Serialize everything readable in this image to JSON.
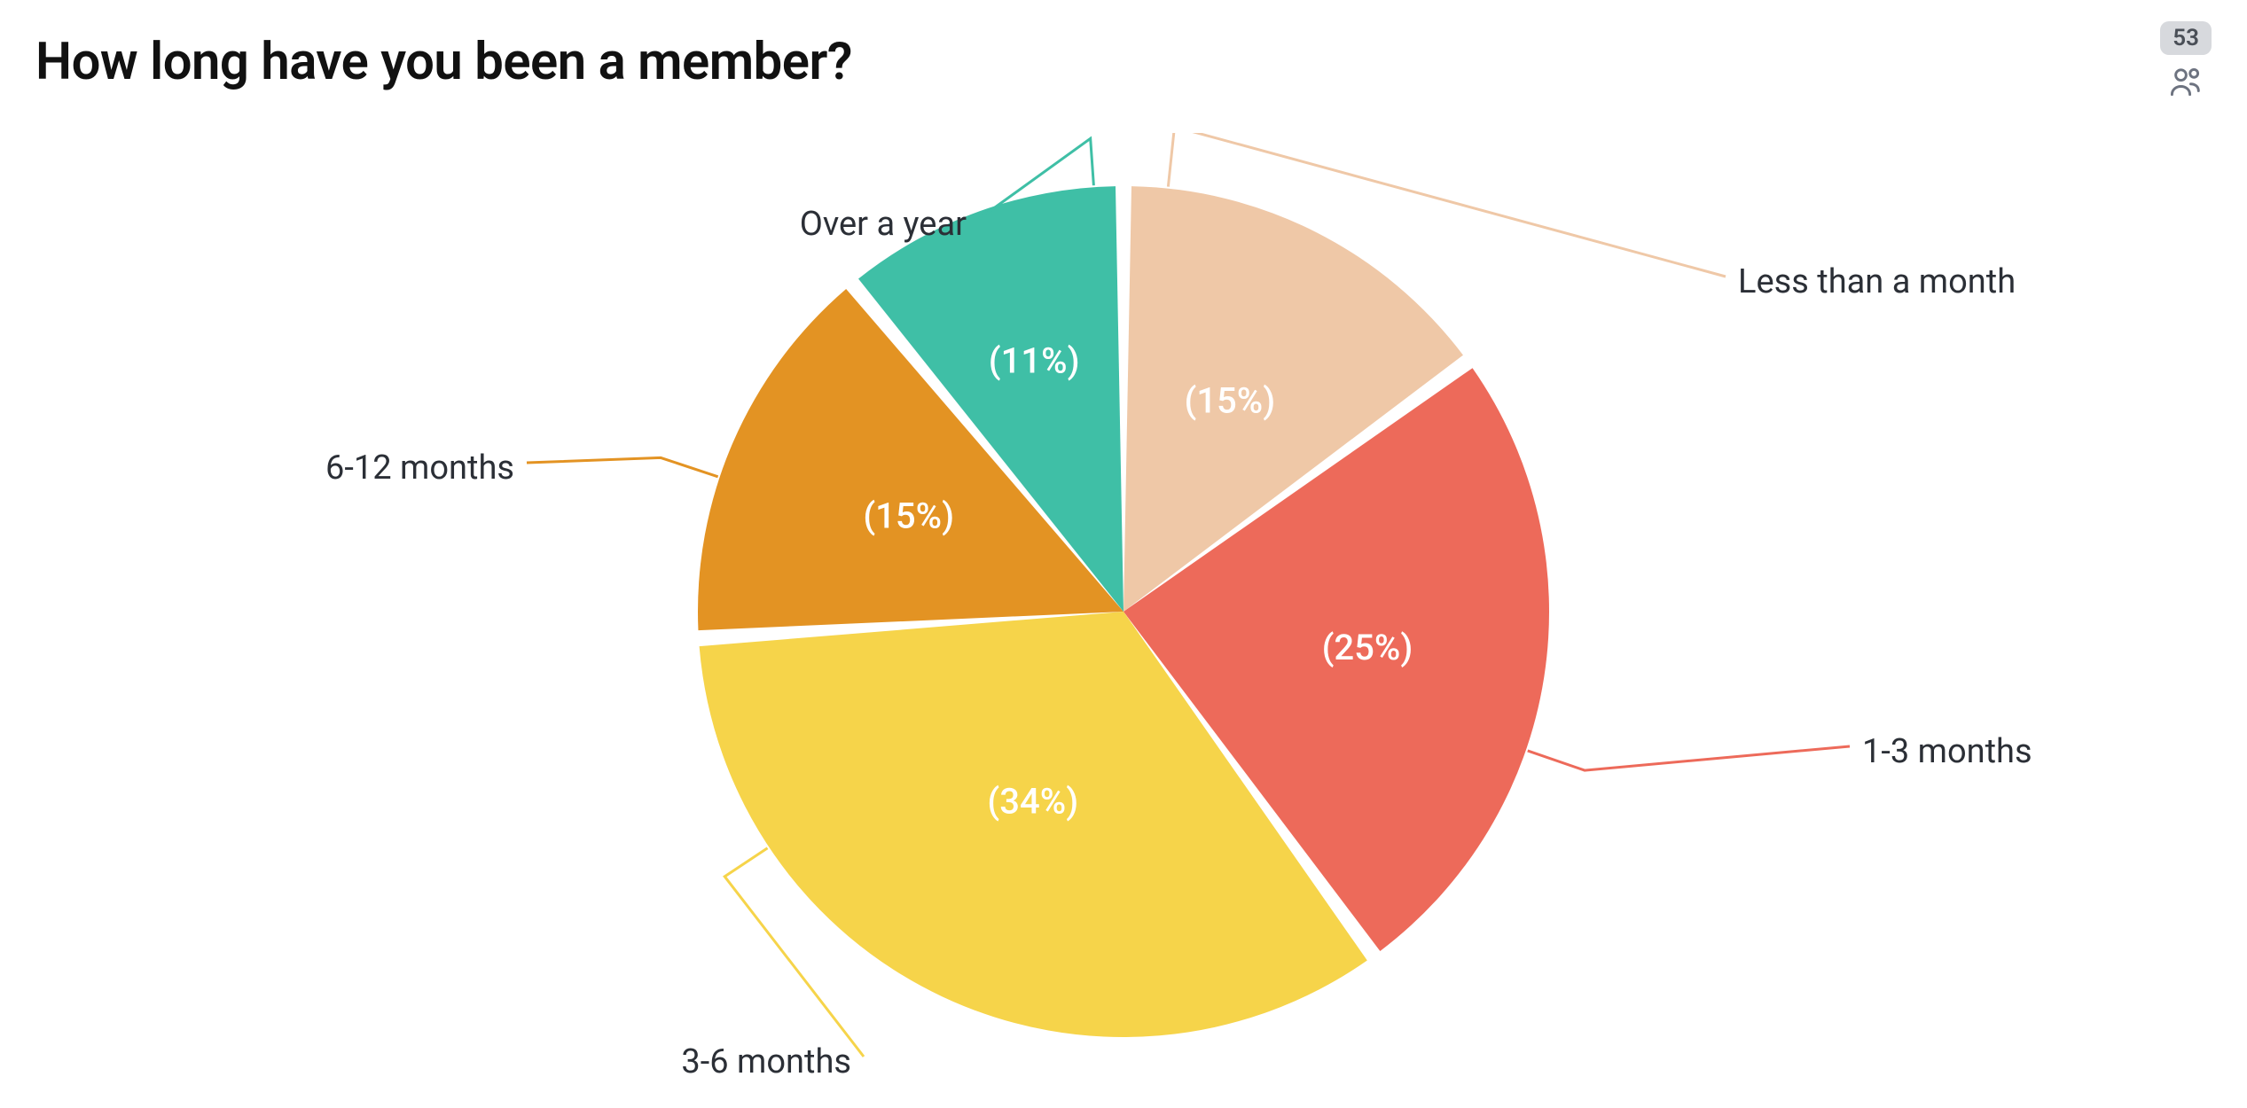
{
  "header": {
    "title": "How long have you been a member?",
    "response_count": "53"
  },
  "chart_data": {
    "type": "pie",
    "title": "How long have you been a member?",
    "categories": [
      "Less than a month",
      "1-3 months",
      "3-6 months",
      "6-12 months",
      "Over a year"
    ],
    "values": [
      15,
      25,
      34,
      15,
      11
    ],
    "unit": "percent",
    "series": [
      {
        "name": "Less than a month",
        "value": 15,
        "pct_label": "(15%)",
        "color": "#efc8a7"
      },
      {
        "name": "1-3 months",
        "value": 25,
        "pct_label": "(25%)",
        "color": "#ed6a5a"
      },
      {
        "name": "3-6 months",
        "value": 34,
        "pct_label": "(34%)",
        "color": "#f6d44a"
      },
      {
        "name": "6-12 months",
        "value": 15,
        "pct_label": "(15%)",
        "color": "#e39323"
      },
      {
        "name": "Over a year",
        "value": 11,
        "pct_label": "(11%)",
        "color": "#3fbfa6"
      }
    ]
  }
}
